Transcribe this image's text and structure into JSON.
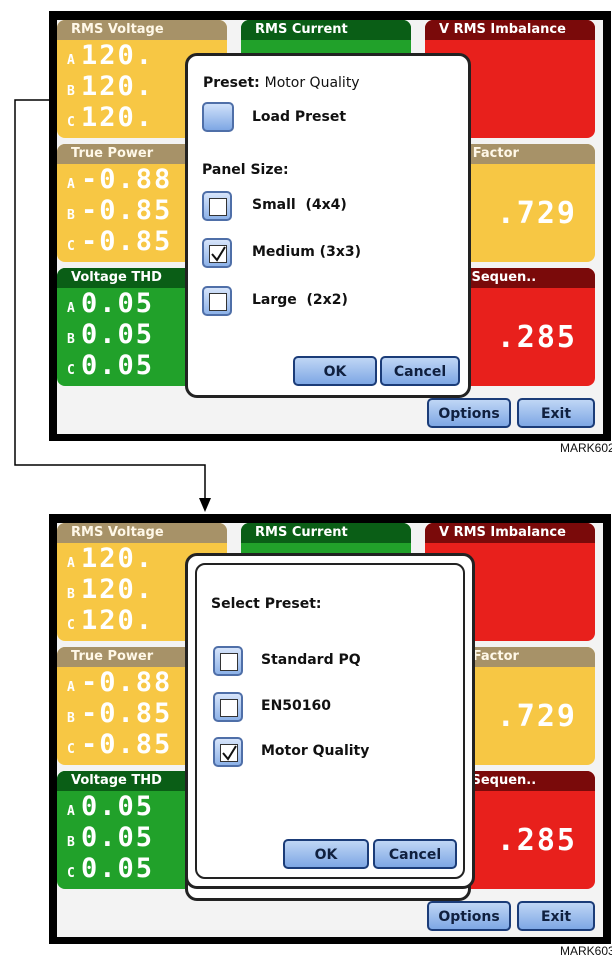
{
  "top_screen": {
    "panels": {
      "rms_voltage": {
        "title": "RMS Voltage",
        "rows": [
          {
            "phase": "A",
            "value": "120."
          },
          {
            "phase": "B",
            "value": "120."
          },
          {
            "phase": "C",
            "value": "120."
          }
        ]
      },
      "rms_current": {
        "title": "RMS Current"
      },
      "v_rms_imbalance": {
        "title": "V RMS Imbalance"
      },
      "true_power": {
        "title": "True Power",
        "rows": [
          {
            "phase": "A",
            "value": "-0.88"
          },
          {
            "phase": "B",
            "value": "-0.85"
          },
          {
            "phase": "C",
            "value": "-0.85"
          }
        ]
      },
      "derating_factor": {
        "title": "ting Factor",
        "value": ".729"
      },
      "voltage_thd": {
        "title": "Voltage THD",
        "rows": [
          {
            "phase": "A",
            "value": "0.05"
          },
          {
            "phase": "B",
            "value": "0.05"
          },
          {
            "phase": "C",
            "value": "0.05"
          }
        ]
      },
      "negative_sequence": {
        "title": "tive Sequen..",
        "value": ".285"
      }
    },
    "dialog": {
      "preset_label": "Preset:",
      "preset_value": "Motor Quality",
      "load_preset": "Load Preset",
      "panel_size_label": "Panel Size:",
      "options": [
        {
          "label": "Small  (4x4)",
          "checked": false
        },
        {
          "label": "Medium (3x3)",
          "checked": true
        },
        {
          "label": "Large  (2x2)",
          "checked": false
        }
      ],
      "ok": "OK",
      "cancel": "Cancel"
    },
    "footer": {
      "options": "Options",
      "exit": "Exit"
    },
    "mark": "MARK602"
  },
  "bottom_screen": {
    "panels": {
      "rms_voltage": {
        "title": "RMS Voltage",
        "rows": [
          {
            "phase": "A",
            "value": "120."
          },
          {
            "phase": "B",
            "value": "120."
          },
          {
            "phase": "C",
            "value": "120."
          }
        ]
      },
      "rms_current": {
        "title": "RMS Current"
      },
      "v_rms_imbalance": {
        "title": "V RMS Imbalance"
      },
      "true_power": {
        "title": "True Power",
        "rows": [
          {
            "phase": "A",
            "value": "-0.88"
          },
          {
            "phase": "B",
            "value": "-0.85"
          },
          {
            "phase": "C",
            "value": "-0.85"
          }
        ]
      },
      "derating_factor": {
        "title": "ting Factor",
        "value": ".729"
      },
      "voltage_thd": {
        "title": "Voltage THD",
        "rows": [
          {
            "phase": "A",
            "value": "0.05"
          },
          {
            "phase": "B",
            "value": "0.05"
          },
          {
            "phase": "C",
            "value": "0.05"
          }
        ]
      },
      "negative_sequence": {
        "title": "tive Sequen..",
        "value": ".285"
      }
    },
    "dialog": {
      "title": "Select Preset:",
      "options": [
        {
          "label": "Standard PQ",
          "checked": false
        },
        {
          "label": "EN50160",
          "checked": false
        },
        {
          "label": "Motor Quality",
          "checked": true
        }
      ],
      "ok": "OK",
      "cancel": "Cancel"
    },
    "footer": {
      "options": "Options",
      "exit": "Exit"
    },
    "mark": "MARK603"
  },
  "colors": {
    "yellow": "#f7c744",
    "red": "#e8201c",
    "green": "#21a12a",
    "button_blue": "#7ea7e4"
  }
}
